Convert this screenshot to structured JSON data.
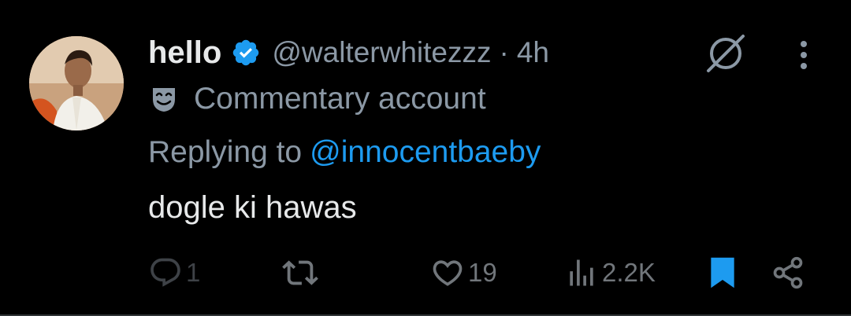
{
  "tweet": {
    "display_name": "hello",
    "handle": "@walterwhitezzz",
    "separator": "·",
    "time": "4h",
    "label": "Commentary account",
    "replying_to_prefix": "Replying to",
    "replying_to_handle": "@innocentbaeby",
    "text": "dogle ki hawas"
  },
  "actions": {
    "reply_count": "1",
    "retweet_count": "",
    "like_count": "19",
    "views_count": "2.2K",
    "bookmarked": true
  },
  "icons": {
    "verified": "verified-badge-icon",
    "grok": "grok-icon",
    "more": "more-vertical-icon",
    "label": "theater-mask-icon",
    "reply": "reply-icon",
    "retweet": "retweet-icon",
    "like": "heart-icon",
    "views": "views-icon",
    "bookmark": "bookmark-icon",
    "share": "share-icon"
  },
  "colors": {
    "background": "#000000",
    "primary_text": "#e7e9ea",
    "secondary_text": "#8b98a5",
    "accent": "#1d9bf0"
  }
}
